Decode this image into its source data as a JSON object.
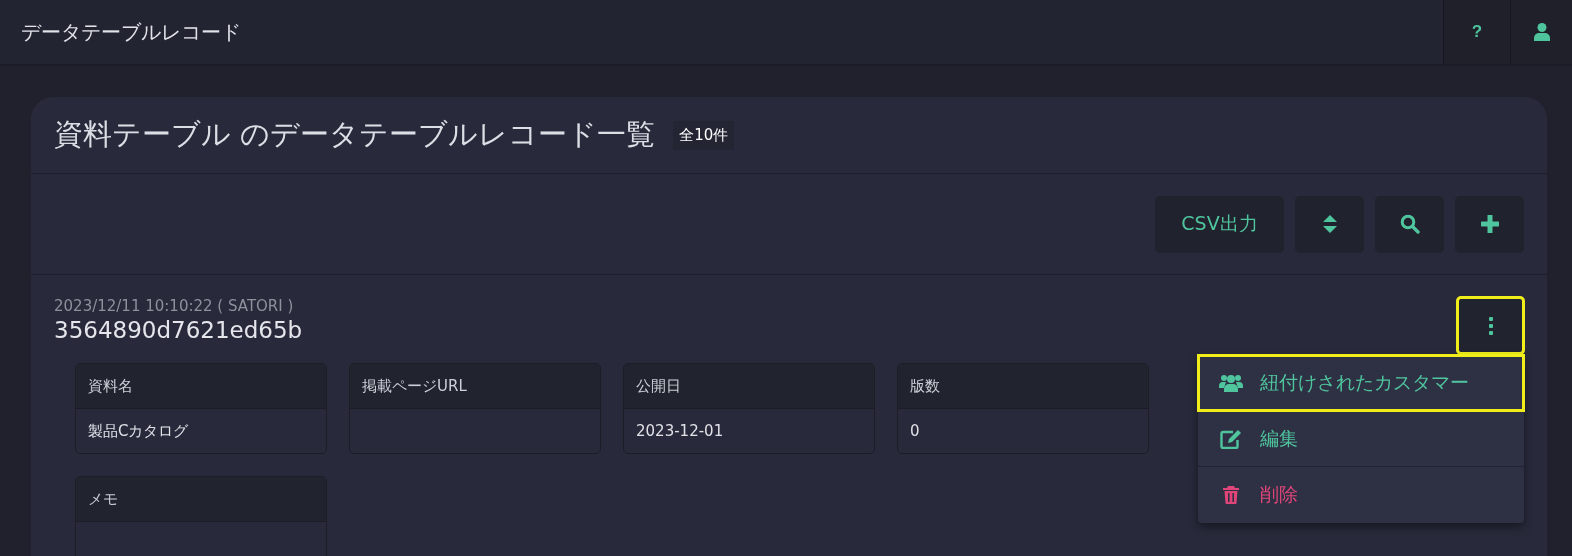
{
  "header": {
    "title": "データテーブルレコード",
    "actions": [
      {
        "kind": "help",
        "label": "?"
      },
      {
        "kind": "user"
      }
    ]
  },
  "card": {
    "title": "資料テーブル のデータテーブルレコード一覧",
    "count": "全10件",
    "toolbar": [
      {
        "kind": "text",
        "label": "CSV出力"
      },
      {
        "kind": "sort"
      },
      {
        "kind": "search"
      },
      {
        "kind": "add"
      }
    ],
    "record": {
      "meta": "2023/12/11 10:10:22 ( SATORI )",
      "id": "3564890d7621ed65b",
      "fields": [
        {
          "label": "資料名",
          "value": "製品Cカタログ"
        },
        {
          "label": "掲載ページURL"
        },
        {
          "label": "公開日",
          "value": "2023-12-01"
        },
        {
          "label": "版数",
          "value": "0"
        },
        {
          "label": "メモ"
        }
      ],
      "menu_button": {
        "highlighted": true
      },
      "menu": [
        {
          "kind": "users",
          "label": "紐付けされたカスタマー",
          "highlighted": true,
          "danger": false
        },
        {
          "kind": "edit",
          "label": "編集",
          "highlighted": false,
          "danger": false
        },
        {
          "kind": "trash",
          "label": "削除",
          "highlighted": false,
          "danger": true
        }
      ]
    }
  }
}
